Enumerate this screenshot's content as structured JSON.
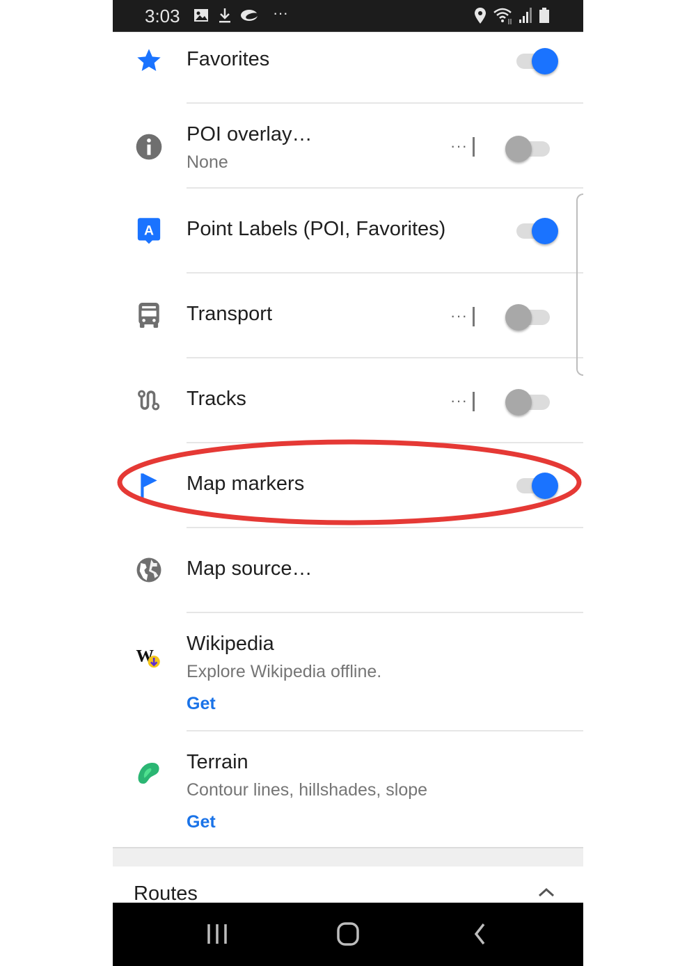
{
  "status_bar": {
    "time": "3:03",
    "left_icons": [
      "gallery-icon",
      "download-icon",
      "cloud-icon",
      "more-notifications-icon"
    ],
    "more_notifications": "···",
    "right_icons": [
      "location-icon",
      "wifi-icon",
      "signal-icon",
      "battery-icon"
    ]
  },
  "layers": [
    {
      "id": "favorites",
      "icon": "star-icon",
      "title": "Favorites",
      "toggle": true,
      "has_options": false
    },
    {
      "id": "poi-overlay",
      "icon": "info-icon",
      "title": "POI overlay…",
      "subtitle": "None",
      "toggle": false,
      "has_options": true
    },
    {
      "id": "point-labels",
      "icon": "label-icon",
      "icon_letter": "A",
      "title": "Point Labels (POI, Favorites)",
      "toggle": true,
      "has_options": false
    },
    {
      "id": "transport",
      "icon": "bus-icon",
      "title": "Transport",
      "toggle": false,
      "has_options": true
    },
    {
      "id": "tracks",
      "icon": "route-icon",
      "title": "Tracks",
      "toggle": false,
      "has_options": true
    },
    {
      "id": "map-markers",
      "icon": "flag-icon",
      "title": "Map markers",
      "toggle": true,
      "has_options": false,
      "highlighted": true
    },
    {
      "id": "map-source",
      "icon": "globe-icon",
      "title": "Map source…"
    },
    {
      "id": "wikipedia",
      "icon": "wikipedia-icon",
      "icon_letter": "W",
      "title": "Wikipedia",
      "subtitle": "Explore Wikipedia offline.",
      "action": "Get"
    },
    {
      "id": "terrain",
      "icon": "terrain-icon",
      "title": "Terrain",
      "subtitle": "Contour lines, hillshades, slope",
      "action": "Get"
    }
  ],
  "options_label": "···",
  "routes_section": {
    "title": "Routes",
    "expanded": true
  },
  "nav_bar": {
    "buttons": [
      "recent-apps",
      "home",
      "back"
    ]
  },
  "colors": {
    "accent": "#1a73ff",
    "link": "#1a73e8",
    "highlight": "#e53935",
    "terrain": "#2bb673",
    "wiki_badge": "#f5c518"
  }
}
